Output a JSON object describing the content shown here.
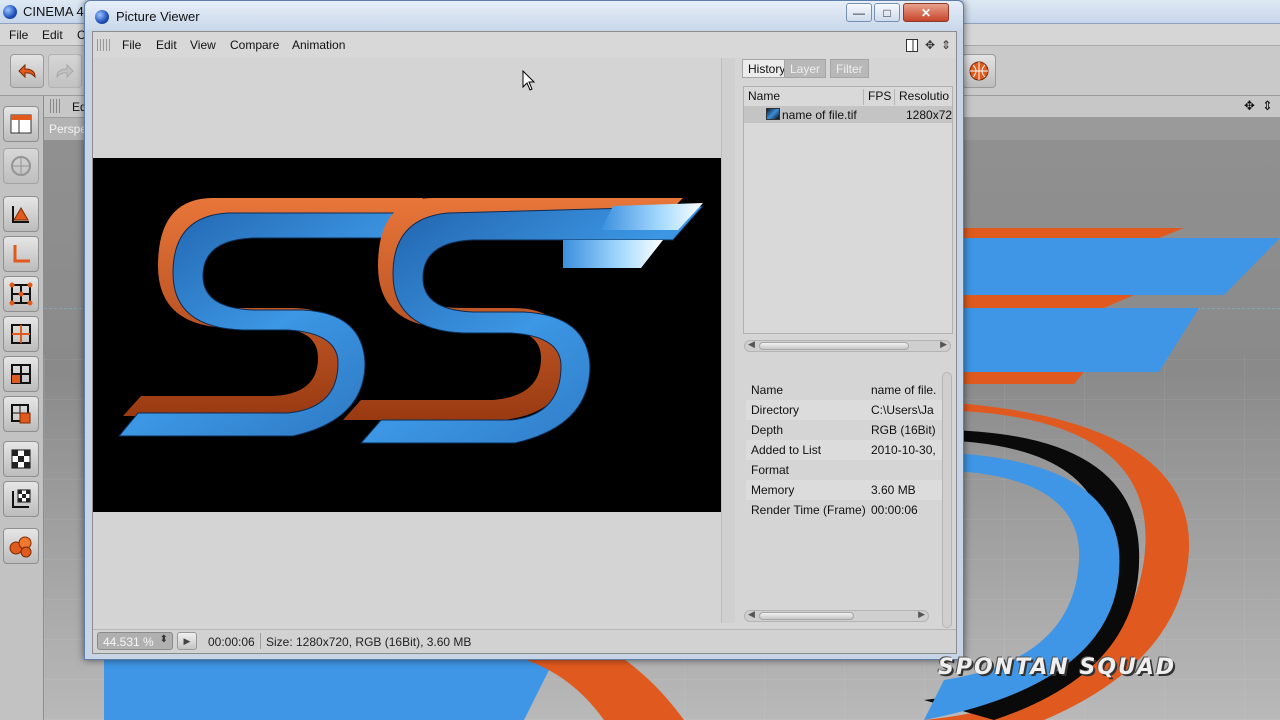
{
  "background_app": {
    "title": "CINEMA 4",
    "menu": [
      "File",
      "Edit",
      "C"
    ],
    "viewport_header_label": "Ed",
    "viewport_tab": "Perspe"
  },
  "picture_viewer": {
    "title": "Picture Viewer",
    "window_controls": {
      "minimize": "—",
      "maximize": "□",
      "close": "✕"
    },
    "menu": [
      "File",
      "Edit",
      "View",
      "Compare",
      "Animation"
    ],
    "tabs": [
      "History",
      "Layer",
      "Filter"
    ],
    "history": {
      "columns": [
        "Name",
        "FPS",
        "Resolutio"
      ],
      "rows": [
        {
          "name": "name of file.tif",
          "fps": "",
          "resolution": "1280x72"
        }
      ]
    },
    "info": [
      {
        "key": "Name",
        "value": "name of file."
      },
      {
        "key": "Directory",
        "value": "C:\\Users\\Ja"
      },
      {
        "key": "Depth",
        "value": "RGB (16Bit)"
      },
      {
        "key": "Added to List",
        "value": "2010-10-30,"
      },
      {
        "key": "Format",
        "value": ""
      },
      {
        "key": "Memory",
        "value": "3.60 MB"
      },
      {
        "key": "Render Time (Frame)",
        "value": "00:00:06"
      }
    ],
    "status": {
      "zoom": "44.531 %",
      "time": "00:00:06",
      "info": "Size: 1280x720, RGB (16Bit), 3.60 MB"
    }
  },
  "watermark": "SPONTAN SQUAD",
  "colors": {
    "accent_blue": "#3b8fde",
    "accent_orange": "#e05a1f",
    "titlebar": "#c9d7ea"
  }
}
